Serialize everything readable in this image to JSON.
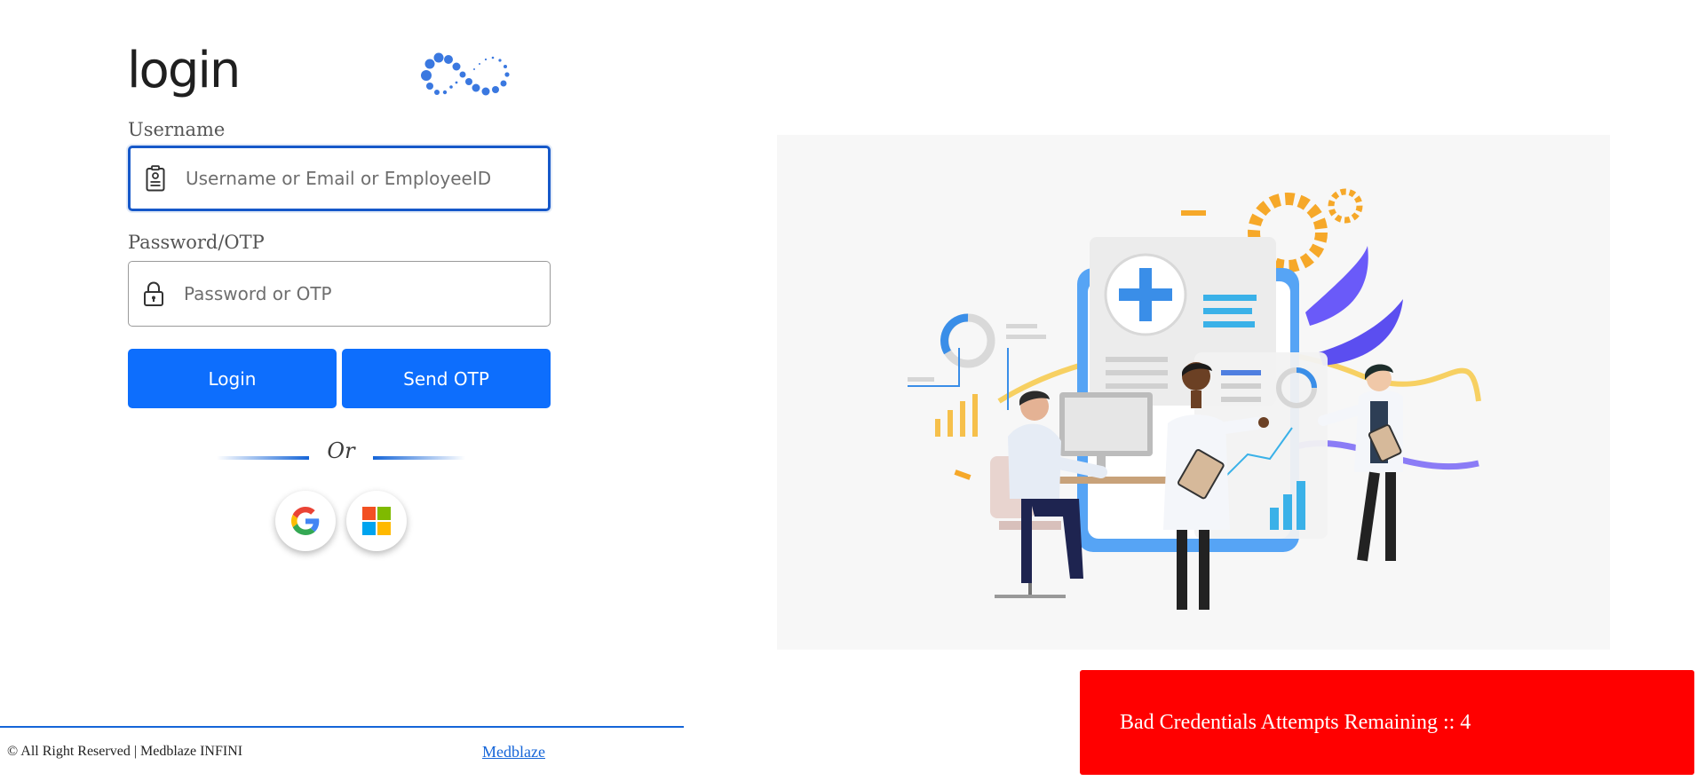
{
  "header": {
    "wordmark": "login"
  },
  "form": {
    "username_label": "Username",
    "username_value": "",
    "username_placeholder": "Username or Email or EmployeeID",
    "password_label": "Password/OTP",
    "password_value": "",
    "password_placeholder": "Password or OTP",
    "login_label": "Login",
    "send_otp_label": "Send OTP",
    "divider_text": "Or"
  },
  "social": [
    {
      "provider": "Google",
      "icon": "google-icon"
    },
    {
      "provider": "Microsoft",
      "icon": "microsoft-icon"
    }
  ],
  "footer": {
    "copyright": "© All Right Reserved | Medblaze INFINI",
    "link_label": "Medblaze"
  },
  "alert": {
    "message": "Bad Credentials Attempts Remaining :: 4"
  },
  "colors": {
    "primary": "#0d6efd",
    "focus_border": "#1658c9",
    "divider": "#1565d8",
    "alert_bg": "#ff0000",
    "logo_blue": "#3a78e0"
  }
}
